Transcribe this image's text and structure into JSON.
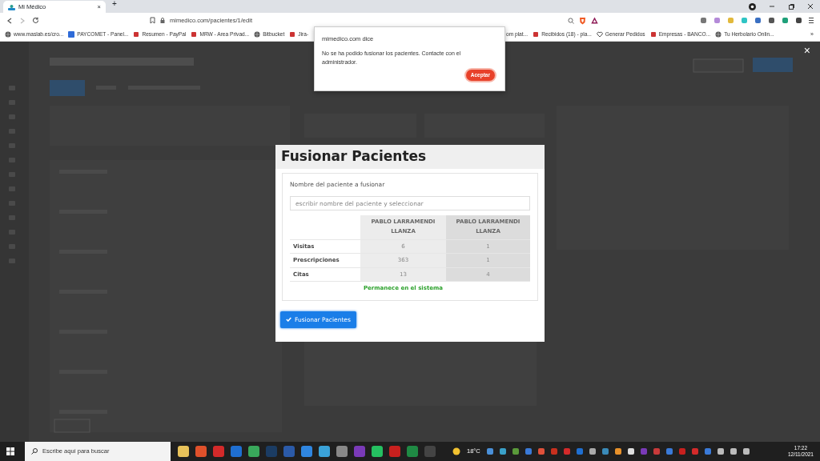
{
  "browser": {
    "tab": {
      "title": "Mi Médico",
      "close": "×"
    },
    "new_tab": "+",
    "url": "mimedico.com/pacientes/1/edit",
    "bookmarks": [
      {
        "label": "www.maslab.es/cro...",
        "kind": "globe"
      },
      {
        "label": "PAYCOMET - Panel...",
        "kind": "square"
      },
      {
        "label": "Resumen - PayPal",
        "kind": "letter"
      },
      {
        "label": "MRW - Area Privad...",
        "kind": "letter"
      },
      {
        "label": "Bitbucket",
        "kind": "globe"
      },
      {
        "label": "Jira-",
        "kind": "letter"
      }
    ],
    "bookmarks_after": [
      {
        "label": "om plat...",
        "kind": "none"
      },
      {
        "label": "Recibidos (18) - pla...",
        "kind": "letter"
      },
      {
        "label": "Generar Pedidos",
        "kind": "heart"
      },
      {
        "label": "Empresas - BANCO...",
        "kind": "letter"
      },
      {
        "label": "Tu Herbolario Onlin...",
        "kind": "globe"
      }
    ],
    "more_bookmarks": "»"
  },
  "page": {
    "close": "×"
  },
  "modal": {
    "title": "Fusionar Pacientes",
    "field_label": "Nombre del paciente a fusionar",
    "search": {
      "placeholder": "escribir nombre del paciente y seleccionar"
    },
    "columns": [
      "PABLO LARRAMENDI LLANZA",
      "PABLO LARRAMENDI LLANZA"
    ],
    "rows": [
      {
        "label": "Visitas",
        "values": [
          "6",
          "1"
        ]
      },
      {
        "label": "Prescripciones",
        "values": [
          "363",
          "1"
        ]
      },
      {
        "label": "Citas",
        "values": [
          "13",
          "4"
        ]
      }
    ],
    "note": "Permanece en el sistema",
    "button": "Fusionar Pacientes"
  },
  "alert": {
    "origin": "mimedico.com dice",
    "message": "No se ha podido fusionar los pacientes. Contacte con el administrador.",
    "button": "Aceptar"
  },
  "taskbar": {
    "search": {
      "placeholder": "Escribe aquí para buscar"
    },
    "weather": "18°C",
    "time": "17:22",
    "date": "12/11/2021"
  }
}
